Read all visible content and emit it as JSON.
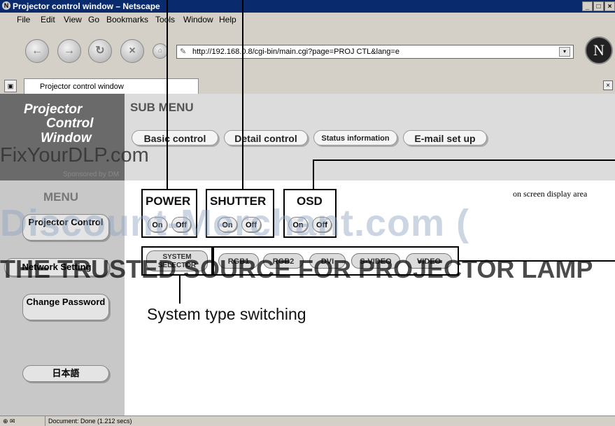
{
  "window": {
    "title": "Projector control window – Netscape",
    "icon": "netscape-icon",
    "controls": [
      "_",
      "□",
      "×"
    ]
  },
  "menubar": [
    "File",
    "Edit",
    "View",
    "Go",
    "Bookmarks",
    "Tools",
    "Window",
    "Help"
  ],
  "toolbar": {
    "back": "←",
    "forward": "→",
    "reload": "↻",
    "stop": "×",
    "home": "⌂",
    "url": "http://192.168.0.8/cgi-bin/main.cgi?page=PROJ CTL&lang=e",
    "dropdown": "▾",
    "logo": "N"
  },
  "tabs": {
    "active": "Projector control window",
    "close": "×"
  },
  "sidebar": {
    "logo_lines": [
      "Projector",
      "Control",
      "Window"
    ],
    "menu_heading": "MENU",
    "items": [
      {
        "label": "Projector Control"
      },
      {
        "label": "Network Setting"
      },
      {
        "label": "Change Password"
      },
      {
        "label": "日本語"
      }
    ]
  },
  "submenu": {
    "heading": "SUB MENU",
    "items": [
      "Basic control",
      "Detail control",
      "Status information",
      "E-mail set up"
    ]
  },
  "controls": {
    "power": {
      "title": "POWER",
      "on": "On",
      "off": "Off"
    },
    "shutter": {
      "title": "SHUTTER",
      "on": "On",
      "off": "Off"
    },
    "osd": {
      "title": "OSD",
      "on": "On",
      "off": "Off"
    },
    "system_selector": "SYSTEM SELECTOR",
    "inputs": [
      "RGB1",
      "RGB2",
      "DVI",
      "S-VIDEO",
      "VIDEO"
    ]
  },
  "annotations": {
    "osd_note": "on screen display area",
    "caption": "System type switching"
  },
  "watermark": {
    "line1": "FixYourDLP.com",
    "line1b": "Sponsored by DM",
    "line2": "Discount-Merchant.com (",
    "line3": "THE TRUSTED SOURCE FOR PROJECTOR LAMP"
  },
  "statusbar": {
    "text": "Document: Done (1.212 secs)"
  }
}
